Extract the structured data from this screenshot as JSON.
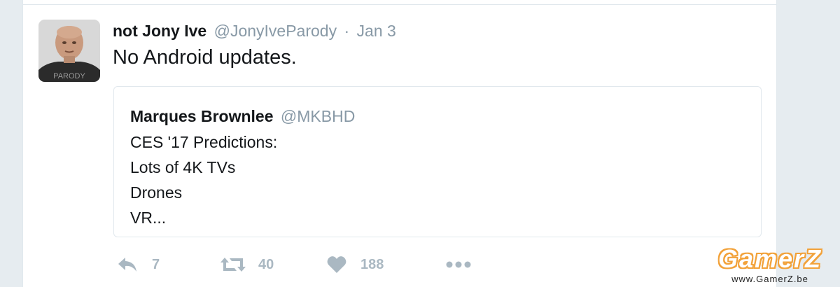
{
  "tweet": {
    "author_name": "not Jony Ive",
    "author_handle": "@JonyIveParody",
    "separator": "·",
    "time": "Jan 3",
    "text": "No Android updates.",
    "avatar_badge": "PARODY"
  },
  "quoted_tweet": {
    "author_name": "Marques Brownlee",
    "author_handle": "@MKBHD",
    "lines": [
      "CES '17 Predictions:",
      "Lots of 4K TVs",
      "Drones",
      "VR..."
    ]
  },
  "actions": {
    "reply": {
      "icon": "reply-icon",
      "count": "7"
    },
    "retweet": {
      "icon": "retweet-icon",
      "count": "40"
    },
    "like": {
      "icon": "heart-icon",
      "count": "188"
    },
    "more": {
      "icon": "more-icon"
    }
  },
  "watermark": {
    "logo": "GamerZ",
    "url": "www.GamerZ.be"
  },
  "colors": {
    "background": "#e6ecf0",
    "text": "#14171a",
    "muted": "#8899a6",
    "action": "#aab8c2",
    "watermark_orange": "#f2a23a"
  }
}
